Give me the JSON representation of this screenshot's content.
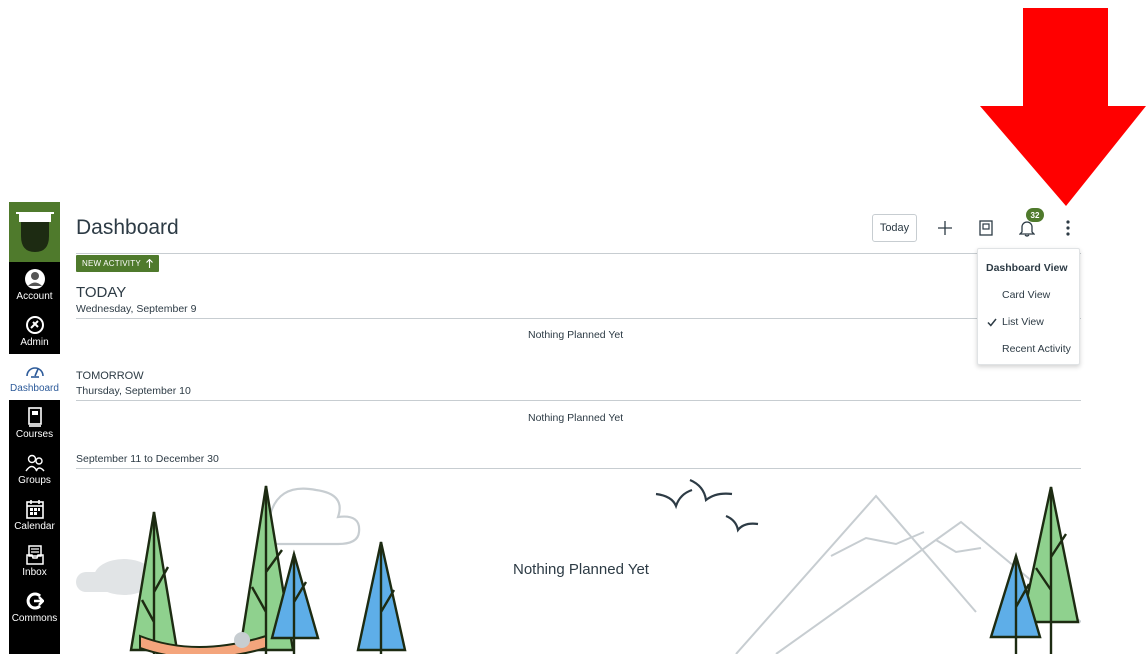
{
  "nav": {
    "items": [
      {
        "label": "Account",
        "icon": "account-icon"
      },
      {
        "label": "Admin",
        "icon": "admin-icon"
      },
      {
        "label": "Dashboard",
        "icon": "dashboard-icon"
      },
      {
        "label": "Courses",
        "icon": "courses-icon"
      },
      {
        "label": "Groups",
        "icon": "groups-icon"
      },
      {
        "label": "Calendar",
        "icon": "calendar-icon"
      },
      {
        "label": "Inbox",
        "icon": "inbox-icon"
      },
      {
        "label": "Commons",
        "icon": "commons-icon"
      }
    ],
    "active": "Dashboard",
    "brand_color": "#4f7a2c"
  },
  "header": {
    "title": "Dashboard",
    "today_label": "Today",
    "notification_count": "32"
  },
  "new_activity": {
    "label": "NEW ACTIVITY"
  },
  "sections": [
    {
      "heading": "TODAY",
      "date": "Wednesday, September 9",
      "empty": "Nothing Planned Yet"
    },
    {
      "heading": "TOMORROW",
      "date": "Thursday, September 10",
      "empty": "Nothing Planned Yet"
    },
    {
      "heading": "September 11 to December 30",
      "empty": "Nothing Planned Yet"
    }
  ],
  "dashboard_menu": {
    "title": "Dashboard View",
    "options": [
      "Card View",
      "List View",
      "Recent Activity"
    ],
    "selected": "List View"
  },
  "colors": {
    "annotation_arrow": "#ff0000",
    "accent": "#4f7a2c"
  }
}
